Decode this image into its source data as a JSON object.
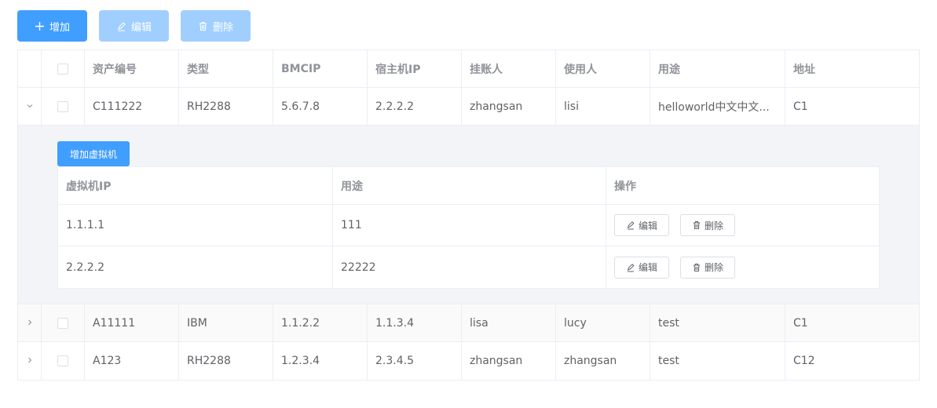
{
  "toolbar": {
    "add_label": "增加",
    "edit_label": "编辑",
    "delete_label": "删除"
  },
  "table": {
    "columns": [
      "资产编号",
      "类型",
      "BMCIP",
      "宿主机IP",
      "挂账人",
      "使用人",
      "用途",
      "地址"
    ],
    "rows": [
      {
        "id": "C111222",
        "type": "RH2288",
        "bmcip": "5.6.7.8",
        "host_ip": "2.2.2.2",
        "owner": "zhangsan",
        "user": "lisi",
        "purpose": "helloworld中文中文...",
        "address": "C1"
      },
      {
        "id": "A11111",
        "type": "IBM",
        "bmcip": "1.1.2.2",
        "host_ip": "1.1.3.4",
        "owner": "lisa",
        "user": "lucy",
        "purpose": "test",
        "address": "C1"
      },
      {
        "id": "A123",
        "type": "RH2288",
        "bmcip": "1.2.3.4",
        "host_ip": "2.3.4.5",
        "owner": "zhangsan",
        "user": "zhangsan",
        "purpose": "test",
        "address": "C12"
      }
    ]
  },
  "vm_panel": {
    "add_vm_label": "增加虚拟机",
    "columns": [
      "虚拟机IP",
      "用途",
      "操作"
    ],
    "rows": [
      {
        "ip": "1.1.1.1",
        "purpose": "111",
        "edit_label": "编辑",
        "delete_label": "删除"
      },
      {
        "ip": "2.2.2.2",
        "purpose": "22222",
        "edit_label": "编辑",
        "delete_label": "删除"
      }
    ]
  },
  "colors": {
    "primary": "#409eff",
    "primary_disabled": "#a0cfff",
    "border": "#ebeef5",
    "expand_bg": "#f3f4f7"
  }
}
